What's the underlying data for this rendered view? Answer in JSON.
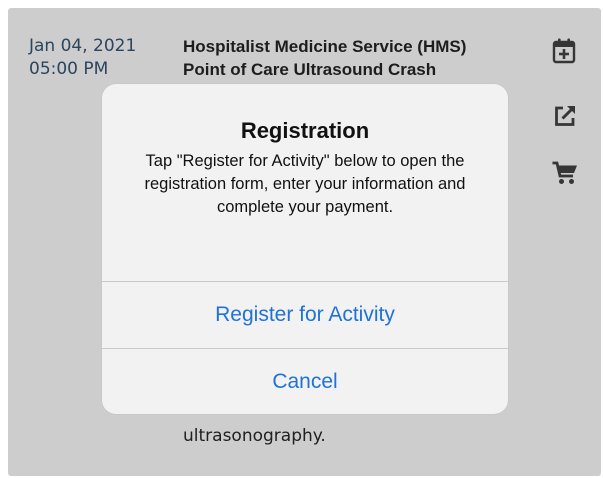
{
  "event": {
    "date": "Jan 04, 2021",
    "time": "05:00 PM",
    "title_line1": "Hospitalist Medicine Service (HMS)",
    "title_line2": "Point of Care Ultrasound Crash",
    "description_tail": "ultrasonography."
  },
  "actions": [
    {
      "name": "add-to-calendar",
      "icon": "calendar-plus-icon"
    },
    {
      "name": "open-external",
      "icon": "external-link-icon"
    },
    {
      "name": "cart",
      "icon": "cart-icon"
    }
  ],
  "dialog": {
    "title": "Registration",
    "message": "Tap \"Register for Activity\" below to open the registration form, enter your information and complete your payment.",
    "register_label": "Register for Activity",
    "cancel_label": "Cancel"
  },
  "colors": {
    "accent": "#1f72d8",
    "date_text": "#2e4a64",
    "background": "#dadada",
    "dialog_bg": "#f2f2f2",
    "icon": "#3a3a3a"
  }
}
